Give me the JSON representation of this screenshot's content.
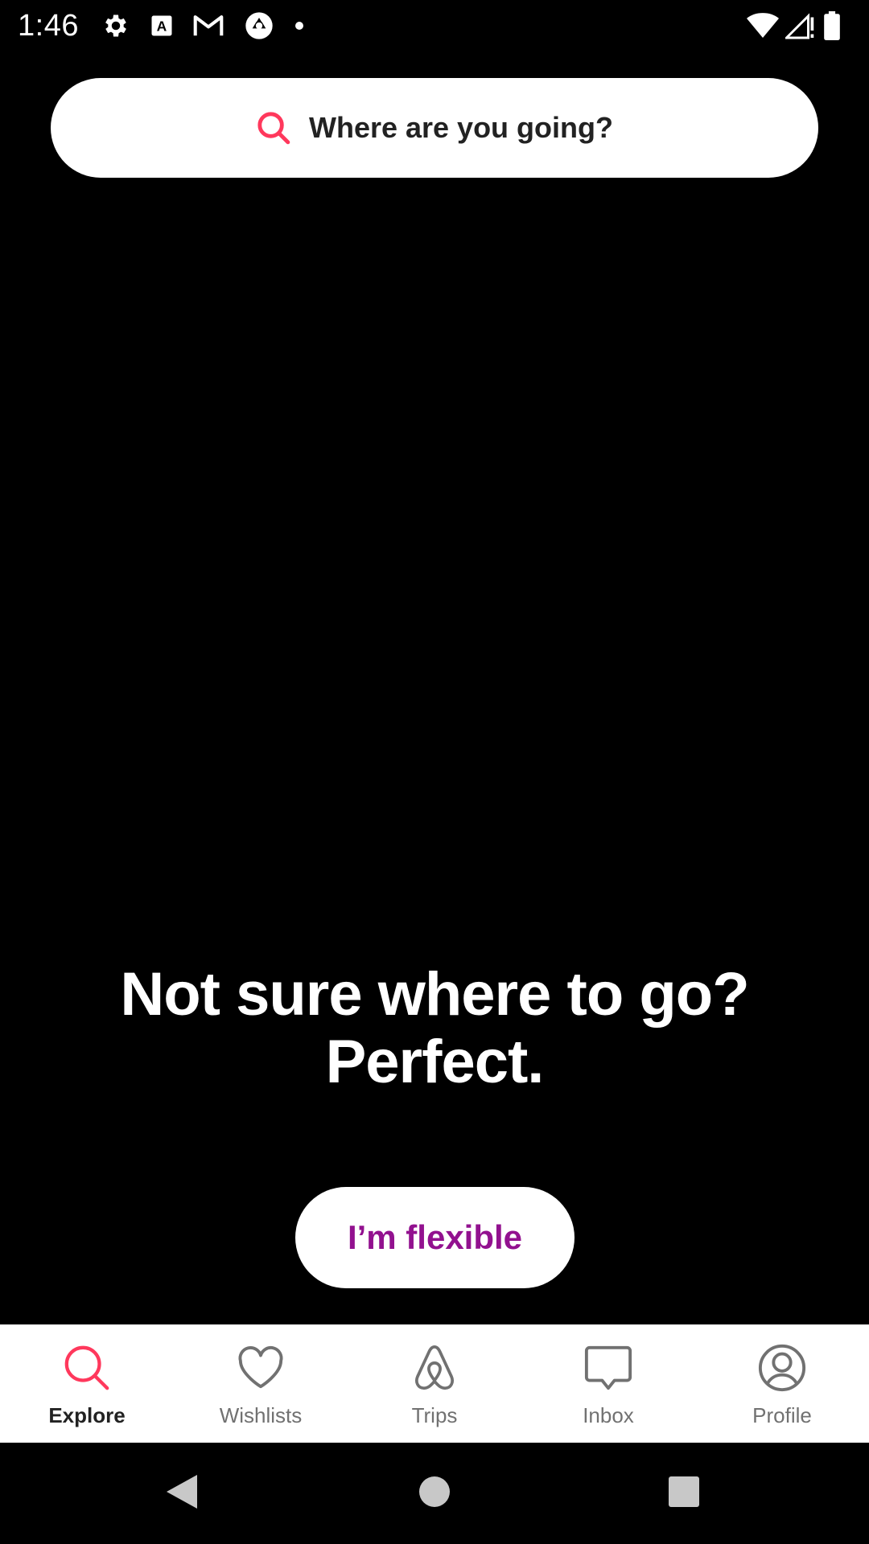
{
  "status_bar": {
    "time": "1:46",
    "icons": [
      "settings-icon",
      "text-a-icon",
      "gmail-icon",
      "camera-shutter-icon",
      "dot-icon",
      "wifi-icon",
      "signal-icon",
      "battery-icon"
    ]
  },
  "search": {
    "placeholder": "Where are you going?",
    "icon": "search-icon",
    "icon_color": "#ff385c"
  },
  "hero": {
    "line1": "Not sure where to go?",
    "line2": "Perfect."
  },
  "flexible_button": {
    "label": "I’m flexible",
    "color": "#92118f"
  },
  "tabs": [
    {
      "label": "Explore",
      "icon": "search-icon",
      "active": true
    },
    {
      "label": "Wishlists",
      "icon": "heart-icon",
      "active": false
    },
    {
      "label": "Trips",
      "icon": "airbnb-logo-icon",
      "active": false
    },
    {
      "label": "Inbox",
      "icon": "message-icon",
      "active": false
    },
    {
      "label": "Profile",
      "icon": "profile-icon",
      "active": false
    }
  ],
  "colors": {
    "accent": "#ff385c",
    "inactive": "#717171",
    "background": "#000000"
  },
  "nav_bar": {
    "buttons": [
      "back-icon",
      "home-icon",
      "recents-icon"
    ]
  }
}
